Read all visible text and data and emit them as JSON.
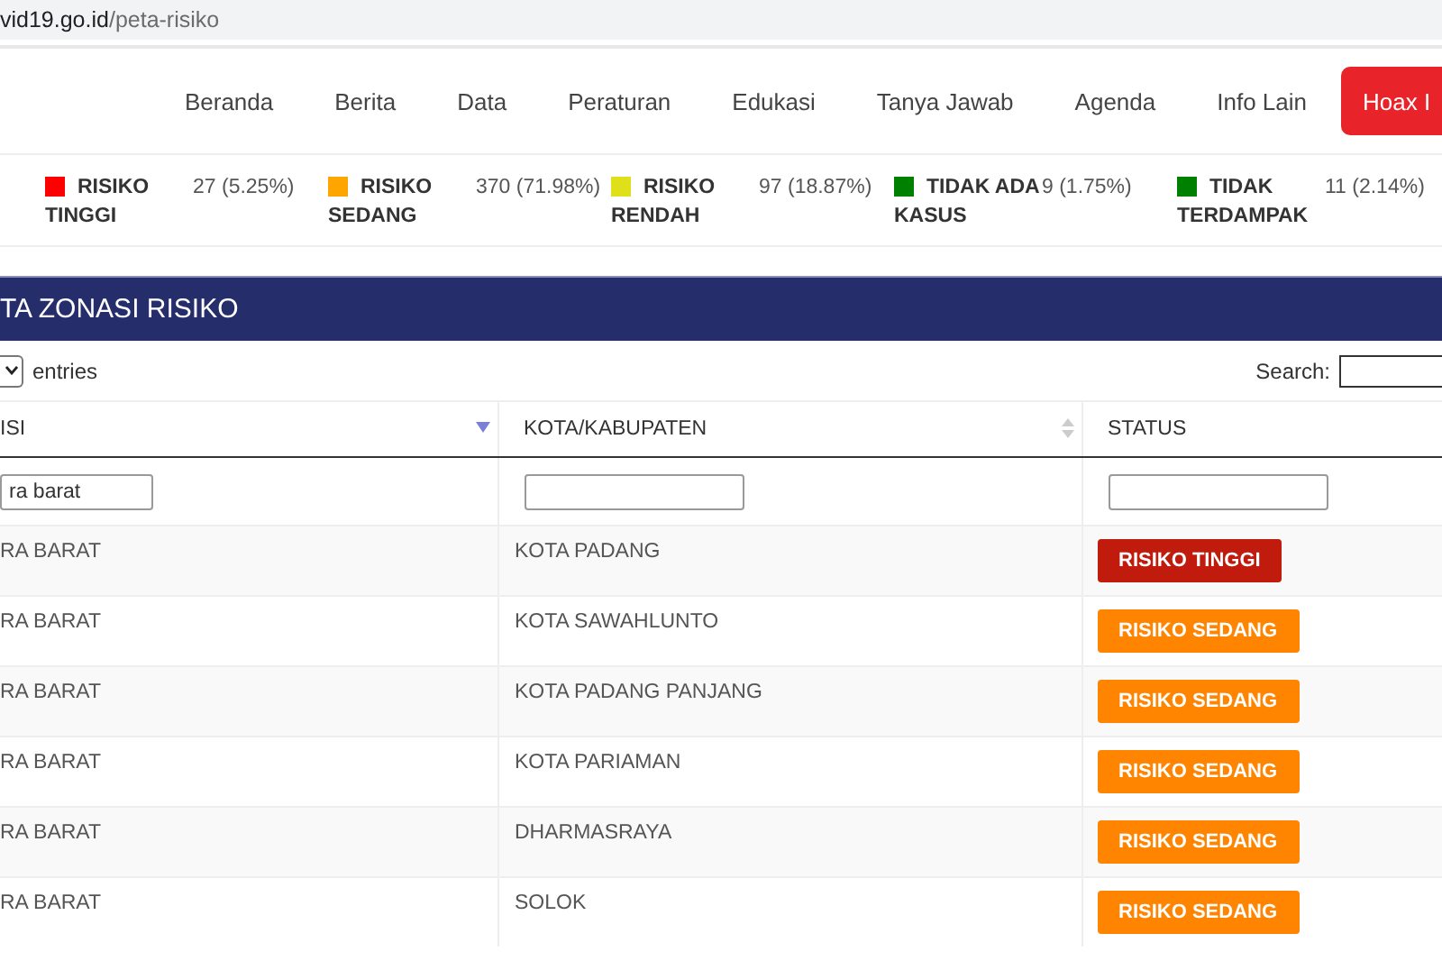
{
  "address_bar": {
    "domain": "vid19.go.id",
    "path": "/peta-risiko"
  },
  "nav": {
    "items": [
      "Beranda",
      "Berita",
      "Data",
      "Peraturan",
      "Edukasi",
      "Tanya Jawab",
      "Agenda",
      "Info Lain"
    ],
    "highlight_button": "Hoax I"
  },
  "legend": [
    {
      "label": "RISIKO TINGGI",
      "count": "27 (5.25%)",
      "color": "#ff0000"
    },
    {
      "label": "RISIKO SEDANG",
      "count": "370 (71.98%)",
      "color": "#ffa500"
    },
    {
      "label": "RISIKO RENDAH",
      "count": "97 (18.87%)",
      "color": "#dfdf1a"
    },
    {
      "label": "TIDAK ADA KASUS",
      "count": "9 (1.75%)",
      "color": "#008000"
    },
    {
      "label": "TIDAK TERDAMPAK",
      "count": "11 (2.14%)",
      "color": "#008000"
    }
  ],
  "panel_title": "TA ZONASI RISIKO",
  "controls": {
    "entries_label": "entries",
    "search_label": "Search:"
  },
  "table": {
    "columns": [
      {
        "label": "ISI",
        "kind": "sorted_desc",
        "filter": "ra barat"
      },
      {
        "label": "KOTA/KABUPATEN",
        "kind": "sortable"
      },
      {
        "label": "STATUS",
        "kind": "plain"
      }
    ],
    "rows": [
      {
        "provinsi": "RA BARAT",
        "kota": "KOTA PADANG",
        "status": "RISIKO TINGGI",
        "kind": "tinggi"
      },
      {
        "provinsi": "RA BARAT",
        "kota": "KOTA SAWAHLUNTO",
        "status": "RISIKO SEDANG",
        "kind": "sedang"
      },
      {
        "provinsi": "RA BARAT",
        "kota": "KOTA PADANG PANJANG",
        "status": "RISIKO SEDANG",
        "kind": "sedang"
      },
      {
        "provinsi": "RA BARAT",
        "kota": "KOTA PARIAMAN",
        "status": "RISIKO SEDANG",
        "kind": "sedang"
      },
      {
        "provinsi": "RA BARAT",
        "kota": "DHARMASRAYA",
        "status": "RISIKO SEDANG",
        "kind": "sedang"
      },
      {
        "provinsi": "RA BARAT",
        "kota": "SOLOK",
        "status": "RISIKO SEDANG",
        "kind": "sedang"
      }
    ]
  }
}
